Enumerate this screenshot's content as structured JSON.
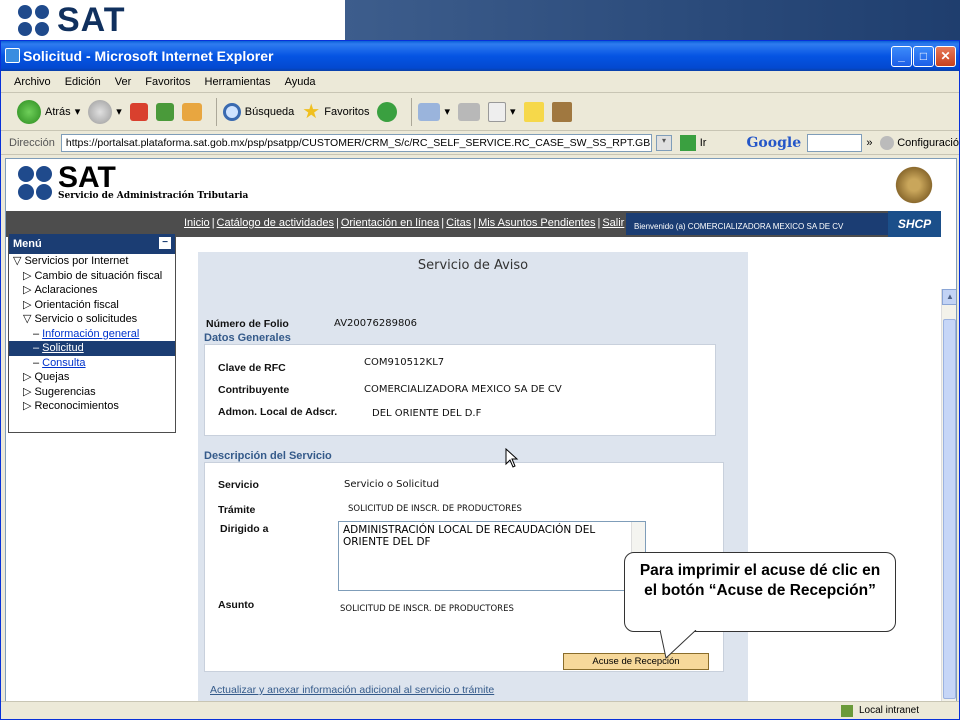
{
  "slide": {
    "logo_text": "SAT"
  },
  "window": {
    "title": "Solicitud - Microsoft Internet Explorer",
    "min": "_",
    "max": "□",
    "close": "✕"
  },
  "menubar": [
    "Archivo",
    "Edición",
    "Ver",
    "Favoritos",
    "Herramientas",
    "Ayuda"
  ],
  "toolbar": {
    "back": "Atrás",
    "search": "Búsqueda",
    "favorites": "Favoritos"
  },
  "addressbar": {
    "label": "Dirección",
    "url": "https://portalsat.plataforma.sat.gob.mx/psp/psatpp/CUSTOMER/CRM_S/c/RC_SELF_SERVICE.RC_CASE_SW_SS_RPT.GBL?D",
    "go": "Ir",
    "google": "Google",
    "config": "Configuració"
  },
  "header": {
    "logo_name": "SAT",
    "logo_sub": "Servicio de Administración Tributaria",
    "nav": [
      "Inicio",
      "Catálogo de actividades",
      "Orientación en línea",
      "Citas",
      "Mis Asuntos Pendientes",
      "Salir"
    ],
    "welcome": "Bienvenido (a) COMERCIALIZADORA MEXICO SA DE CV",
    "shcp": "SHCP"
  },
  "menu": {
    "title": "Menú",
    "collapse": "−",
    "items": [
      {
        "label": "Servicios por Internet",
        "marker": "▽",
        "level": 0
      },
      {
        "label": "Cambio de situación fiscal",
        "marker": "▷",
        "level": 1
      },
      {
        "label": "Aclaraciones",
        "marker": "▷",
        "level": 1
      },
      {
        "label": "Orientación fiscal",
        "marker": "▷",
        "level": 1
      },
      {
        "label": "Servicio o solicitudes",
        "marker": "▽",
        "level": 1
      },
      {
        "label": "Información general",
        "marker": "–",
        "level": 2,
        "link": true
      },
      {
        "label": "Solicitud",
        "marker": "–",
        "level": 2,
        "link": true,
        "selected": true
      },
      {
        "label": "Consulta",
        "marker": "–",
        "level": 2,
        "link": true
      },
      {
        "label": "Quejas",
        "marker": "▷",
        "level": 1
      },
      {
        "label": "Sugerencias",
        "marker": "▷",
        "level": 1
      },
      {
        "label": "Reconocimientos",
        "marker": "▷",
        "level": 1
      }
    ]
  },
  "content": {
    "title": "Servicio de Aviso",
    "folio_label": "Número de Folio",
    "folio_value": "AV20076289806",
    "general_header": "Datos Generales",
    "rfc_label": "Clave de RFC",
    "rfc_value": "COM910512KL7",
    "contrib_label": "Contribuyente",
    "contrib_value": "COMERCIALIZADORA MEXICO SA DE CV",
    "admon_label": "Admon. Local de Adscr.",
    "admon_value": "DEL ORIENTE DEL D.F",
    "desc_header": "Descripción del Servicio",
    "servicio_label": "Servicio",
    "servicio_value": "Servicio o Solicitud",
    "tramite_label": "Trámite",
    "tramite_value": "SOLICITUD DE INSCR. DE PRODUCTORES",
    "dirigido_label": "Dirigido a",
    "dirigido_value": "ADMINISTRACIÓN LOCAL DE RECAUDACIÓN DEL ORIENTE DEL DF",
    "asunto_label": "Asunto",
    "asunto_value": "SOLICITUD DE INSCR. DE PRODUCTORES",
    "acuse_button": "Acuse de Recepción",
    "actualizar_link": "Actualizar y anexar información adicional al servicio o trámite"
  },
  "statusbar": {
    "zone": "Local intranet"
  },
  "callout": {
    "text": "Para imprimir el acuse dé clic en el botón “Acuse de Recepción”"
  }
}
